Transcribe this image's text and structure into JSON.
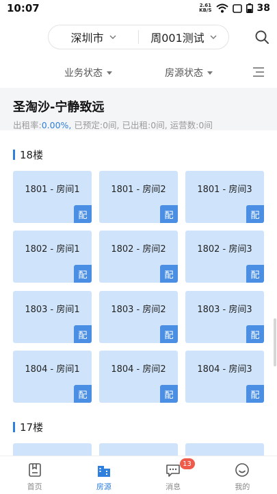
{
  "status_bar": {
    "time": "10:07",
    "net_speed_value": "2.61",
    "net_speed_unit": "KB/S",
    "battery": "38"
  },
  "header": {
    "city": "深圳市",
    "project": "周001测试",
    "icons": {
      "search": "search-icon",
      "chevron": "chevron-down-icon"
    }
  },
  "filters": {
    "business_status": "业务状态",
    "house_status": "房源状态",
    "menu_icon": "menu-icon"
  },
  "building": {
    "name": "圣淘沙-宁静致远",
    "occupancy_label": "出租率:",
    "occupancy_value": "0.00%,",
    "reserved_label": "已预定:",
    "reserved_value": "0间,",
    "rented_label": "已出租:",
    "rented_value": "0间,",
    "operating_label": "运营数:",
    "operating_value": "0间",
    "accent_color": "#2f7fde"
  },
  "floors": [
    {
      "label": "18楼",
      "rooms": [
        {
          "label": "1801 - 房间1",
          "tag": "配"
        },
        {
          "label": "1801 - 房间2",
          "tag": "配"
        },
        {
          "label": "1801 - 房间3",
          "tag": "配"
        },
        {
          "label": "1802 - 房间1",
          "tag": "配"
        },
        {
          "label": "1802 - 房间2",
          "tag": "配"
        },
        {
          "label": "1802 - 房间3",
          "tag": "配"
        },
        {
          "label": "1803 - 房间1",
          "tag": "配"
        },
        {
          "label": "1803 - 房间2",
          "tag": "配"
        },
        {
          "label": "1803 - 房间3",
          "tag": "配"
        },
        {
          "label": "1804 - 房间1",
          "tag": "配"
        },
        {
          "label": "1804 - 房间2",
          "tag": "配"
        },
        {
          "label": "1804 - 房间3",
          "tag": "配"
        }
      ]
    },
    {
      "label": "17楼"
    }
  ],
  "bottom_nav": {
    "items": [
      {
        "label": "首页",
        "icon": "home-icon"
      },
      {
        "label": "房源",
        "icon": "building-icon"
      },
      {
        "label": "消息",
        "icon": "message-icon",
        "badge": "13"
      },
      {
        "label": "我的",
        "icon": "profile-icon"
      }
    ],
    "active_index": 1,
    "active_color": "#2f7fde",
    "badge_color": "#f05a4a"
  }
}
